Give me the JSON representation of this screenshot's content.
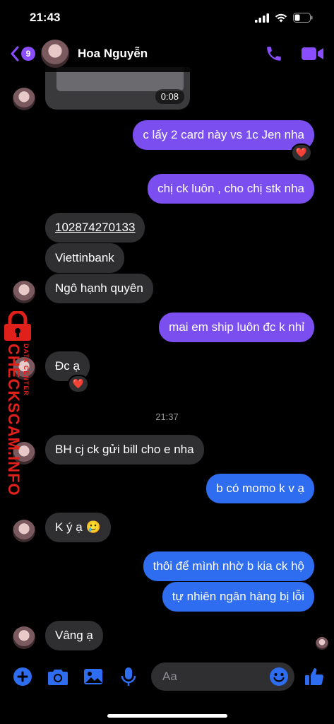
{
  "status_bar": {
    "time": "21:43"
  },
  "header": {
    "unread_count": "9",
    "contact_name": "Hoa Nguyễn"
  },
  "video": {
    "duration": "0:08"
  },
  "messages": [
    {
      "text": "c lấy 2 card này vs 1c Jen nha",
      "reaction": "❤️"
    },
    {
      "text": "chị ck luôn , cho chị stk nha"
    },
    {
      "text": "102874270133"
    },
    {
      "text": "Viettinbank"
    },
    {
      "text": "Ngô hạnh quyên"
    },
    {
      "text": "mai em ship luôn đc k nhỉ"
    },
    {
      "text": "Đc ạ",
      "reaction": "❤️"
    },
    {
      "text": "BH cj ck gửi bill cho e nha"
    },
    {
      "text": "b có momo k v ạ"
    },
    {
      "text": "K ý ạ 🥲"
    },
    {
      "text": "thôi để mình nhờ b kia ck hộ"
    },
    {
      "text": "tự nhiên ngân hàng bị lỗi"
    },
    {
      "text": "Vâng ạ"
    }
  ],
  "timestamp": "21:37",
  "watermark": {
    "main": "CHECKSCAM.INFO",
    "sub": "DATA CENTER"
  },
  "composer": {
    "placeholder": "Aa"
  },
  "colors": {
    "accent": "#8a4dff",
    "outgoing_purple": "#7b4ef0",
    "outgoing_blue": "#2e6cf0",
    "incoming": "#2f2f31"
  }
}
